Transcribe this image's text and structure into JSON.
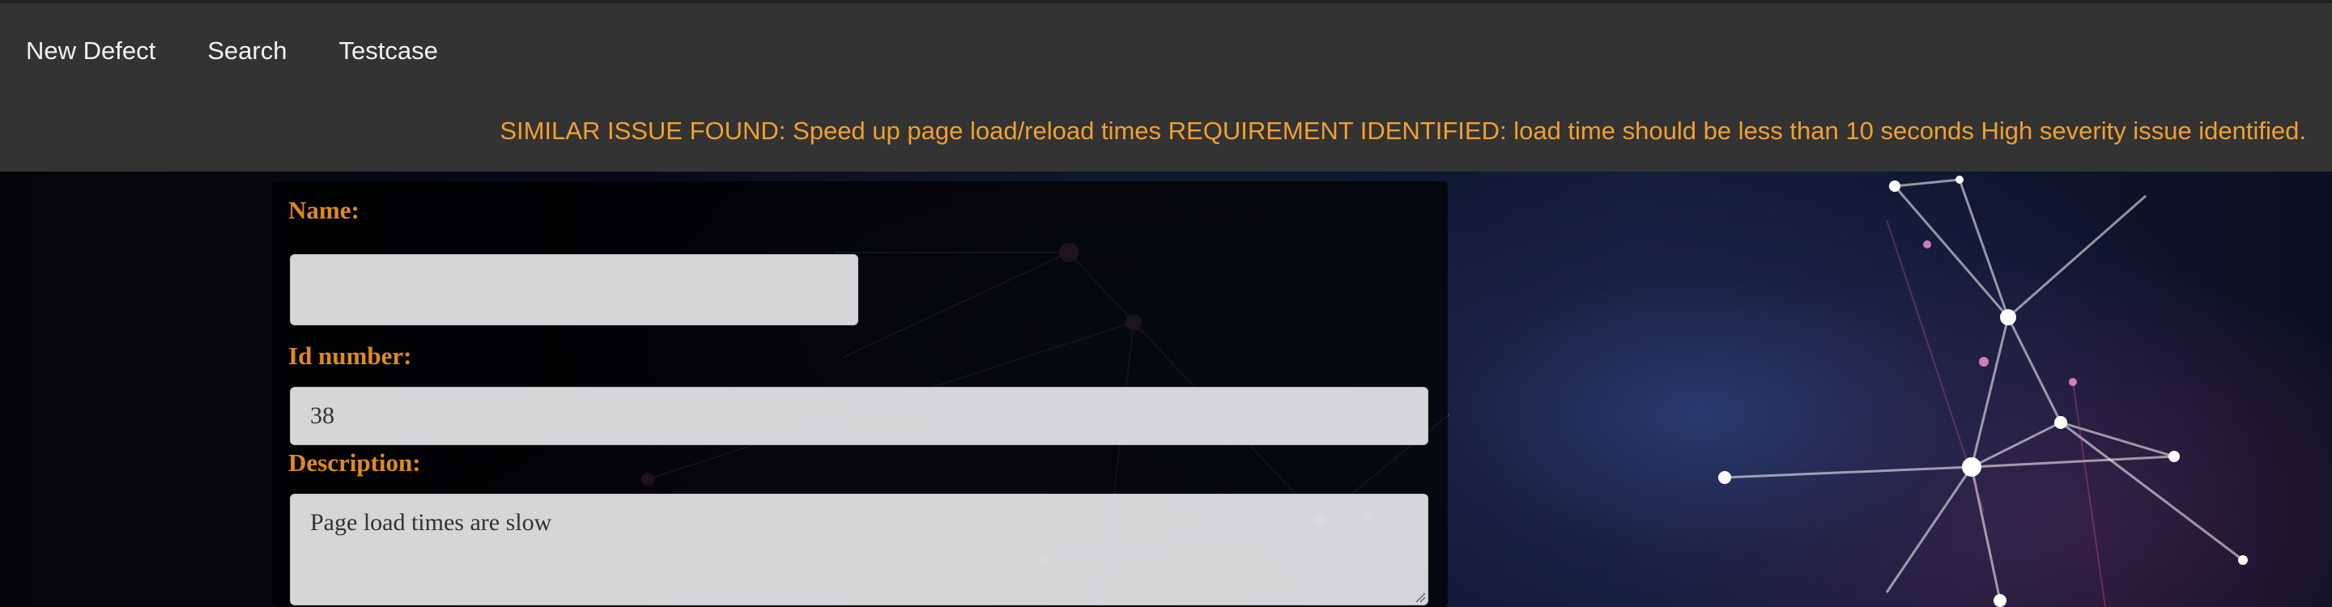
{
  "nav": {
    "items": [
      {
        "label": "New Defect"
      },
      {
        "label": "Search"
      },
      {
        "label": "Testcase"
      }
    ]
  },
  "alert": {
    "text": "SIMILAR ISSUE FOUND: Speed up page load/reload times REQUIREMENT IDENTIFIED: load time should be less than 10 seconds High severity issue identified.",
    "color": "#f0a030"
  },
  "form": {
    "name": {
      "label": "Name:",
      "value": ""
    },
    "id_number": {
      "label": "Id number:",
      "value": "38"
    },
    "description": {
      "label": "Description:",
      "value": "Page load times are slow"
    }
  },
  "colors": {
    "nav_bg": "#333333",
    "nav_text": "#f2f2f2",
    "label": "#e08a1e",
    "input_bg": "#e8e8ec"
  },
  "background": {
    "icon": "network-nodes-image"
  }
}
